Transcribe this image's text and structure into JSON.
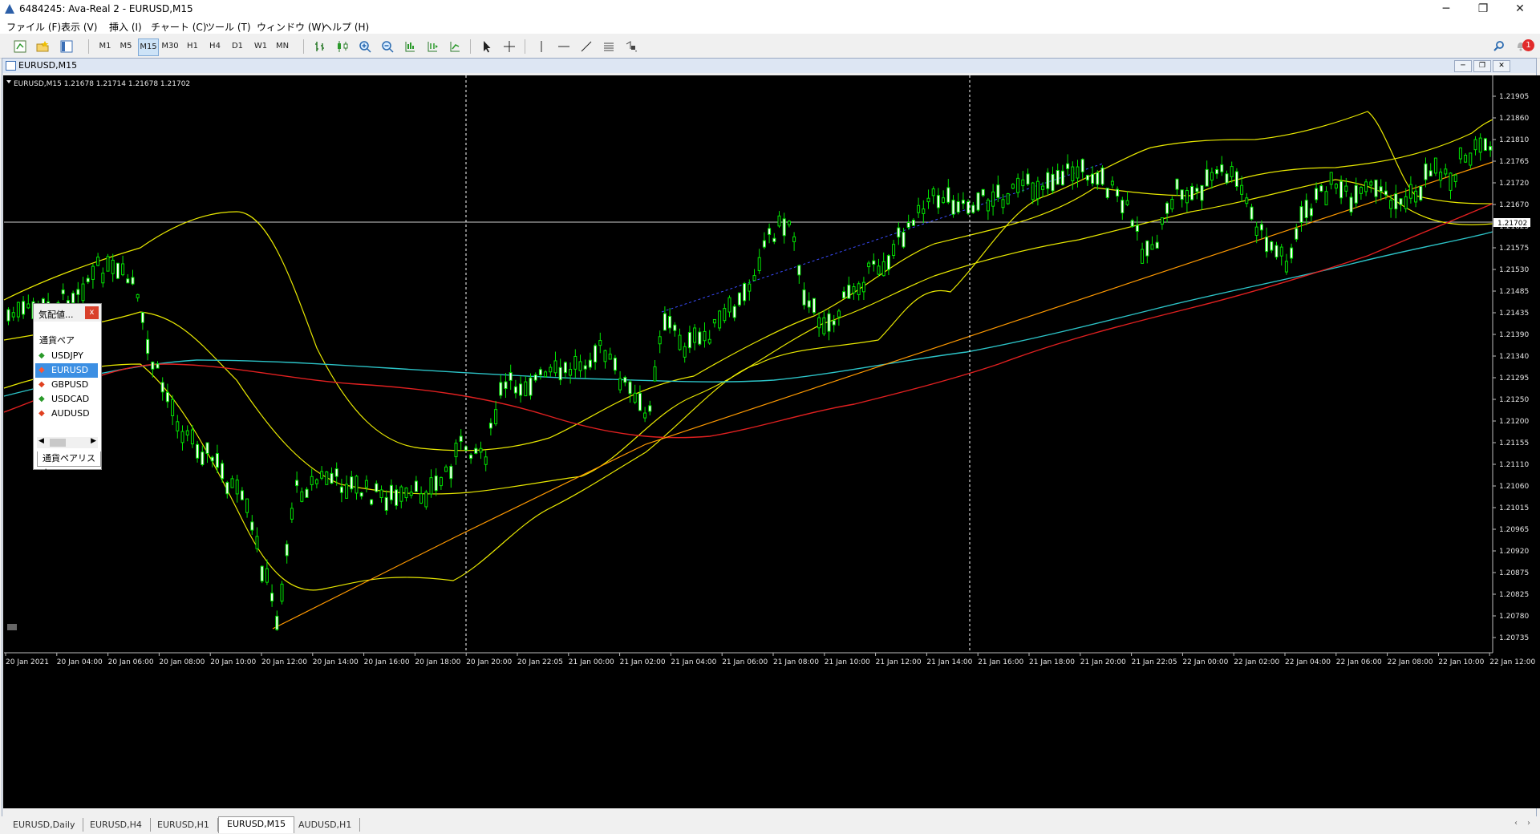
{
  "window": {
    "title": "6484245: Ava-Real 2 - EURUSD,M15",
    "controls": [
      "─",
      "❐",
      "✕"
    ]
  },
  "menu": [
    "ファイル (F)",
    "表示 (V)",
    "挿入 (I)",
    "チャート (C)",
    "ツール (T)",
    "ウィンドウ (W)",
    "ヘルプ (H)"
  ],
  "toolbar": {
    "timeframes": [
      "M1",
      "M5",
      "M15",
      "M30",
      "H1",
      "H4",
      "D1",
      "W1",
      "MN"
    ],
    "active_timeframe": "M15",
    "alert_count": "1"
  },
  "chart_window": {
    "title": "EURUSD,M15",
    "controls": [
      "─",
      "❐",
      "✕"
    ]
  },
  "chart": {
    "header": "EURUSD,M15  1.21678 1.21714 1.21678 1.21702",
    "current_price": "1.21702",
    "price_labels": [
      "1.21905",
      "1.21860",
      "1.21810",
      "1.21765",
      "1.21720",
      "1.21670",
      "1.21625",
      "1.21575",
      "1.21530",
      "1.21485",
      "1.21435",
      "1.21390",
      "1.21340",
      "1.21295",
      "1.21250",
      "1.21200",
      "1.21155",
      "1.21110",
      "1.21060",
      "1.21015",
      "1.20965",
      "1.20920",
      "1.20875",
      "1.20825",
      "1.20780",
      "1.20735"
    ],
    "time_labels": [
      "20 Jan 2021",
      "20 Jan 04:00",
      "20 Jan 06:00",
      "20 Jan 08:00",
      "20 Jan 10:00",
      "20 Jan 12:00",
      "20 Jan 14:00",
      "20 Jan 16:00",
      "20 Jan 18:00",
      "20 Jan 20:00",
      "20 Jan 22:05",
      "21 Jan 00:00",
      "21 Jan 02:00",
      "21 Jan 04:00",
      "21 Jan 06:00",
      "21 Jan 08:00",
      "21 Jan 10:00",
      "21 Jan 12:00",
      "21 Jan 14:00",
      "21 Jan 16:00",
      "21 Jan 18:00",
      "21 Jan 20:00",
      "21 Jan 22:05",
      "22 Jan 00:00",
      "22 Jan 02:00",
      "22 Jan 04:00",
      "22 Jan 06:00",
      "22 Jan 08:00",
      "22 Jan 10:00",
      "22 Jan 12:00"
    ],
    "colors": {
      "bg": "#000000",
      "candle": "#00e600",
      "bands": "#e8e800",
      "ma_long": "#2cc4c8",
      "ma_mid": "#e02020",
      "trend": "#ff9900"
    }
  },
  "market_watch": {
    "title": "気配値...",
    "close": "x",
    "column": "通貨ペア",
    "symbols": [
      {
        "name": "USDJPY",
        "dir": "up"
      },
      {
        "name": "EURUSD",
        "dir": "down",
        "selected": true
      },
      {
        "name": "GBPUSD",
        "dir": "down"
      },
      {
        "name": "USDCAD",
        "dir": "up"
      },
      {
        "name": "AUDUSD",
        "dir": "down"
      }
    ],
    "footer_tab": "通貨ペアリスト"
  },
  "tabs": [
    "EURUSD,Daily",
    "EURUSD,H4",
    "EURUSD,H1",
    "EURUSD,M15",
    "AUDUSD,H1"
  ],
  "active_tab": "EURUSD,M15"
}
